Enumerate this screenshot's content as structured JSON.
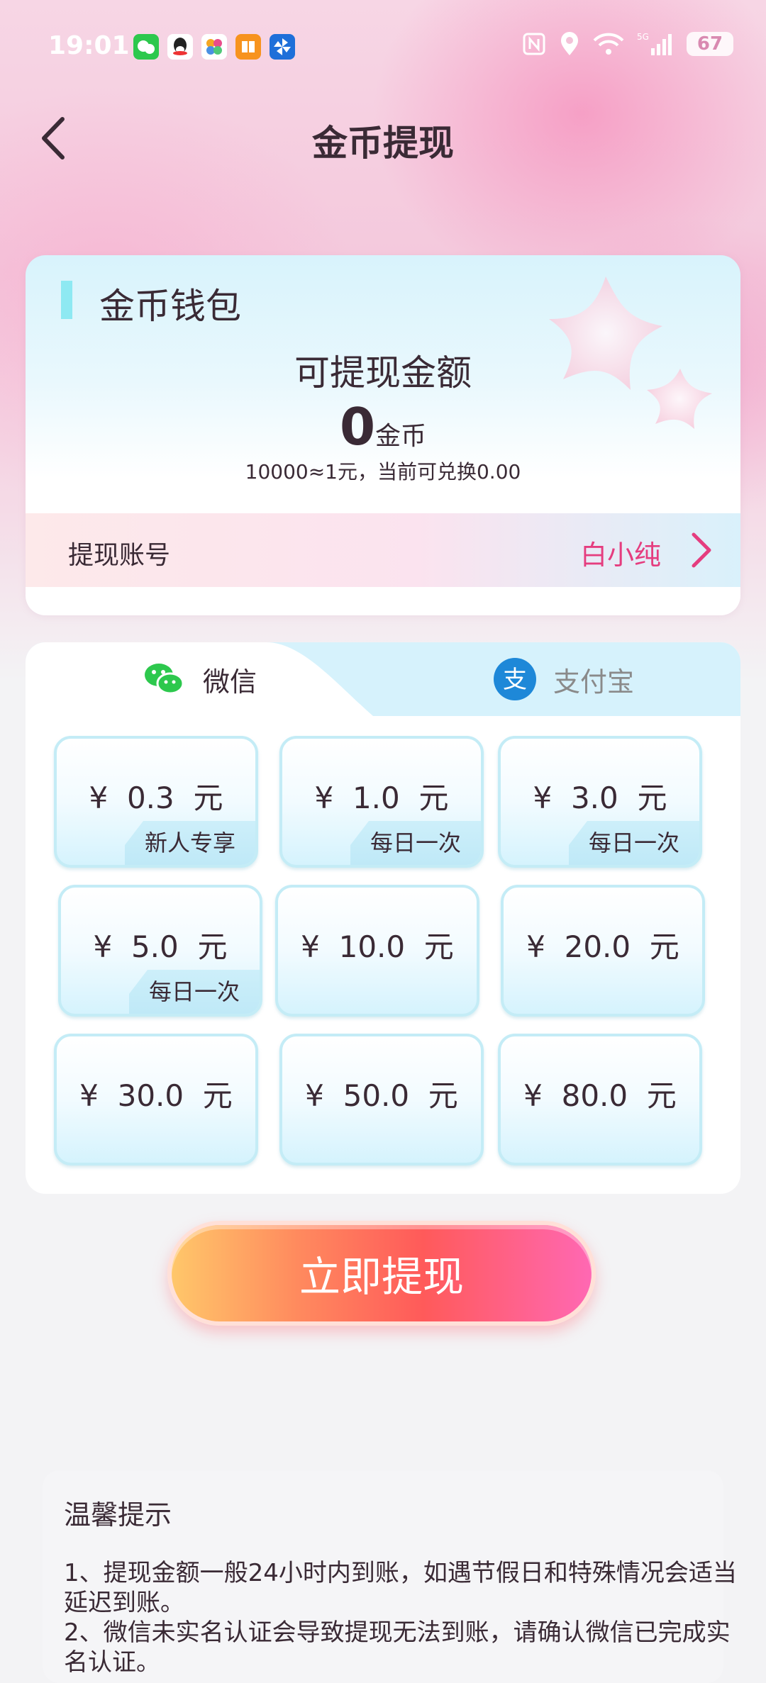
{
  "status_bar": {
    "time": "19:01",
    "battery": "67",
    "icons": [
      "wechat-icon",
      "qq-icon",
      "photos-icon",
      "reader-icon",
      "pinwheel-icon",
      "nfc-icon",
      "location-icon",
      "wifi-icon",
      "5g-signal-icon",
      "battery-icon"
    ]
  },
  "header": {
    "title": "金币提现"
  },
  "wallet": {
    "title": "金币钱包",
    "balance_label": "可提现金额",
    "balance_value": "0",
    "balance_unit": "金币",
    "rate_note": "10000≈1元，当前可兑换0.00",
    "account_label": "提现账号",
    "account_name": "白小纯"
  },
  "tabs": {
    "wechat": "微信",
    "alipay": "支付宝"
  },
  "options": [
    {
      "amount": "¥  0.3  元",
      "tag": "新人专享"
    },
    {
      "amount": "¥  1.0  元",
      "tag": "每日一次"
    },
    {
      "amount": "¥  3.0  元",
      "tag": "每日一次"
    },
    {
      "amount": "¥  5.0  元",
      "tag": "每日一次"
    },
    {
      "amount": "¥  10.0  元",
      "tag": ""
    },
    {
      "amount": "¥  20.0  元",
      "tag": ""
    },
    {
      "amount": "¥  30.0  元",
      "tag": ""
    },
    {
      "amount": "¥  50.0  元",
      "tag": ""
    },
    {
      "amount": "¥  80.0  元",
      "tag": ""
    }
  ],
  "submit_label": "立即提现",
  "tips": {
    "title": "温馨提示",
    "line1": "1、提现金额一般24小时内到账，如遇节假日和特殊情况会适当延迟到账。",
    "line2": "2、微信未实名认证会导致提现无法到账，请确认微信已完成实名认证。"
  },
  "colors": {
    "accent": "#e53d7f",
    "card_border": "#c4ecf6",
    "tab_inactive": "#d6f2fc"
  }
}
